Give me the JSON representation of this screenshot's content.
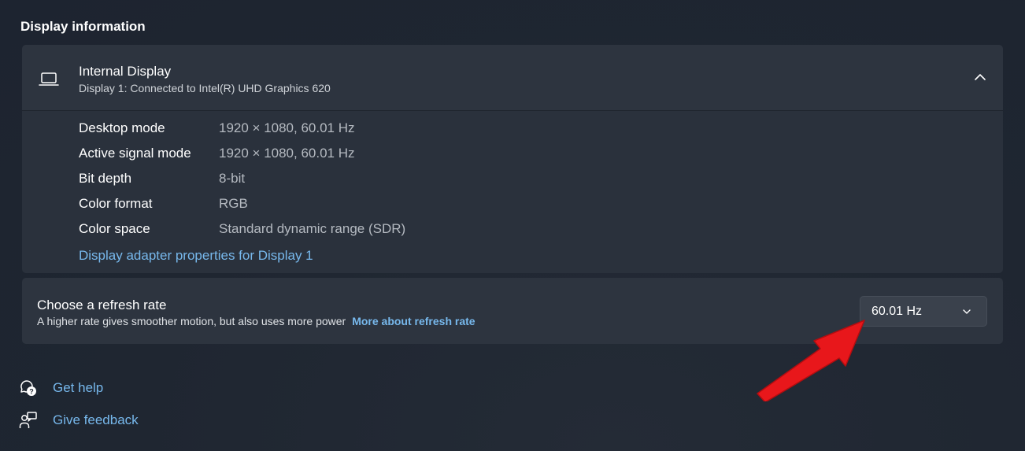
{
  "section": {
    "title": "Display information"
  },
  "display": {
    "name": "Internal Display",
    "subtitle": "Display 1: Connected to Intel(R) UHD Graphics 620",
    "icon": "laptop-icon",
    "expanded": true,
    "details": [
      {
        "label": "Desktop mode",
        "value": "1920 × 1080, 60.01 Hz"
      },
      {
        "label": "Active signal mode",
        "value": "1920 × 1080, 60.01 Hz"
      },
      {
        "label": "Bit depth",
        "value": "8-bit"
      },
      {
        "label": "Color format",
        "value": "RGB"
      },
      {
        "label": "Color space",
        "value": "Standard dynamic range (SDR)"
      }
    ],
    "adapter_link": "Display adapter properties for Display 1"
  },
  "refresh_rate": {
    "title": "Choose a refresh rate",
    "description": "A higher rate gives smoother motion, but also uses more power",
    "link": "More about refresh rate",
    "selected": "60.01 Hz"
  },
  "footer": {
    "help": "Get help",
    "feedback": "Give feedback"
  },
  "colors": {
    "accent_link": "#77b8ec",
    "annotation_arrow": "#e8171b",
    "background": "#1f2631",
    "card": "#2d343f"
  }
}
